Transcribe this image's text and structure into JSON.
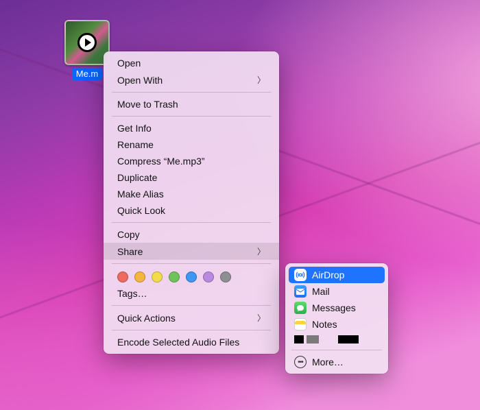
{
  "file": {
    "name": "Me.mp3",
    "displayed_label": "Me.m"
  },
  "context_menu": {
    "open": "Open",
    "open_with": "Open With",
    "move_to_trash": "Move to Trash",
    "get_info": "Get Info",
    "rename": "Rename",
    "compress": "Compress “Me.mp3”",
    "duplicate": "Duplicate",
    "make_alias": "Make Alias",
    "quick_look": "Quick Look",
    "copy": "Copy",
    "share": "Share",
    "tags": "Tags…",
    "quick_actions": "Quick Actions",
    "encode": "Encode Selected Audio Files",
    "tag_colors": [
      "#ee6b5e",
      "#f4b63f",
      "#f4db4a",
      "#70c35b",
      "#3e97f0",
      "#b98ae0",
      "#8e8e93"
    ]
  },
  "share_submenu": {
    "airdrop": "AirDrop",
    "mail": "Mail",
    "messages": "Messages",
    "notes": "Notes",
    "more": "More…"
  },
  "icons": {
    "airdrop_bg": "#ffffff",
    "mail_bg": "#1f8cff",
    "messages_bg": "#35c759",
    "notes_bg": "#ffffff"
  }
}
